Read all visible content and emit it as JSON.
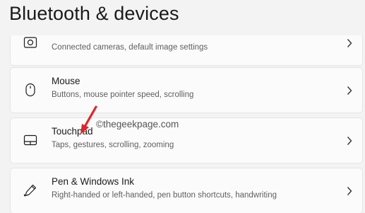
{
  "page": {
    "title": "Bluetooth & devices"
  },
  "items": [
    {
      "title": "",
      "description": "Connected cameras, default image settings",
      "icon": "camera-icon"
    },
    {
      "title": "Mouse",
      "description": "Buttons, mouse pointer speed, scrolling",
      "icon": "mouse-icon"
    },
    {
      "title": "Touchpad",
      "description": "Taps, gestures, scrolling, zooming",
      "icon": "touchpad-icon"
    },
    {
      "title": "Pen & Windows Ink",
      "description": "Right-handed or left-handed, pen button shortcuts, handwriting",
      "icon": "pen-icon"
    }
  ],
  "watermark": "©thegeekpage.com",
  "colors": {
    "background": "#f3f3f3",
    "card": "#fbfbfb",
    "annotation_arrow": "#e0242a"
  }
}
